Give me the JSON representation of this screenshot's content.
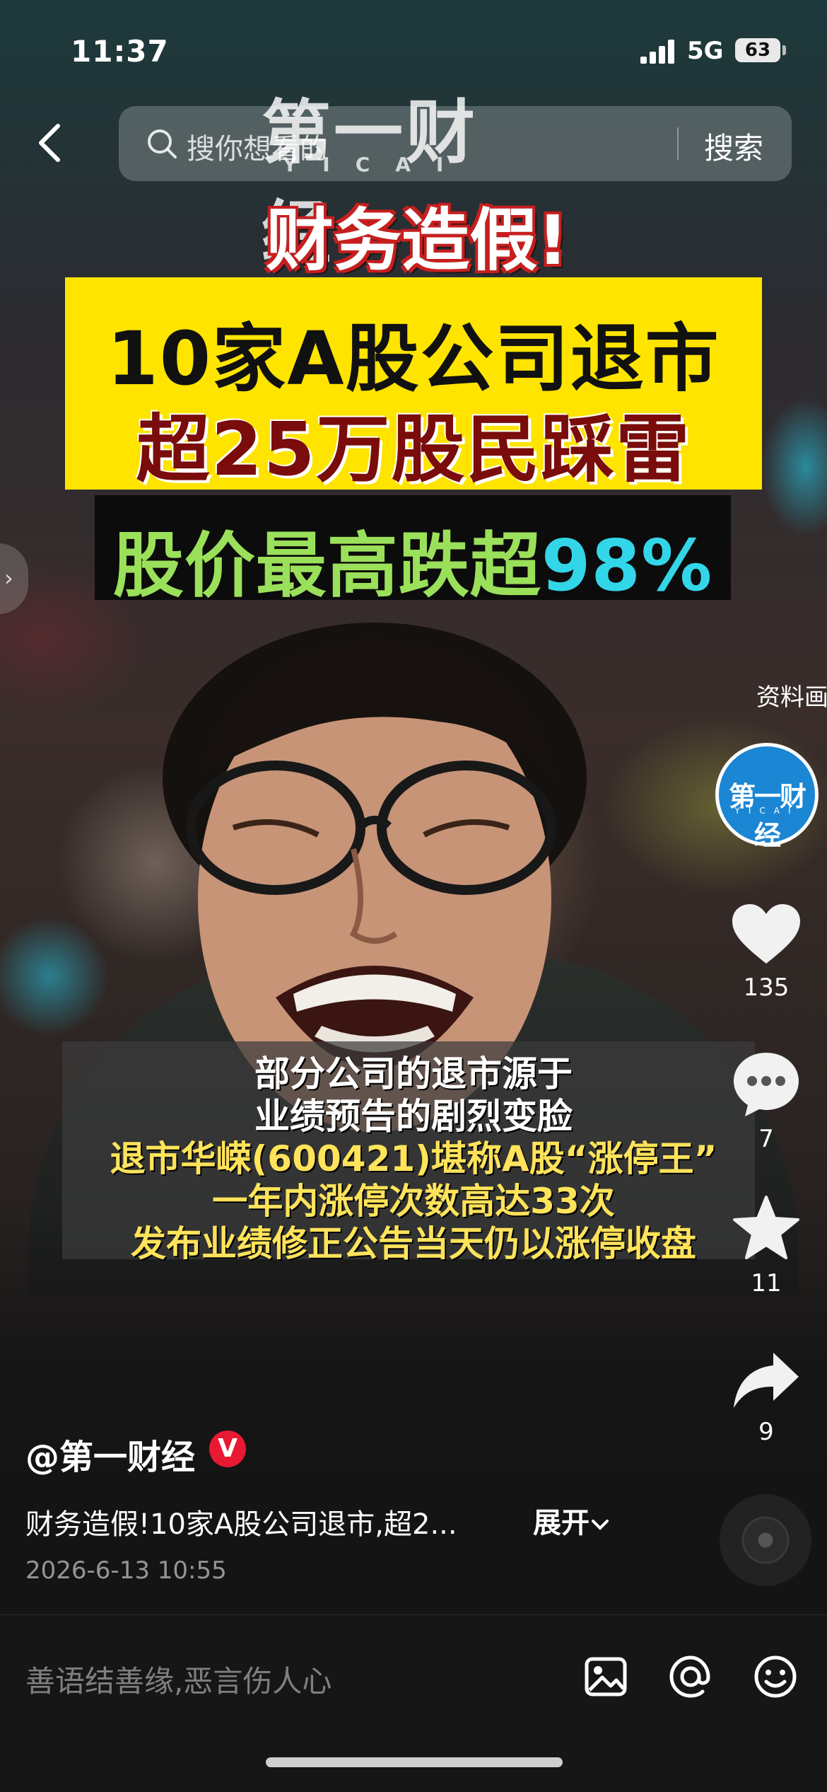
{
  "status_bar": {
    "time": "11:37",
    "network": "5G",
    "battery": "63"
  },
  "search": {
    "placeholder": "搜你想看的",
    "button": "搜索"
  },
  "watermark": {
    "main": "第一财经",
    "sub": "YICAI"
  },
  "headline": {
    "title": "财务造假!",
    "line1": "10家A股公司退市",
    "line2": "超25万股民踩雷",
    "line3_prefix": "股价最高跌超",
    "line3_pct": "98%"
  },
  "subtitles": [
    "部分公司的退市源于",
    "业绩预告的剧烈变脸",
    "退市华嵘(600421)堪称A股“涨停王”",
    "一年内涨停次数高达33次",
    "发布业绩修正公告当天仍以涨停收盘"
  ],
  "source_label": "资料画面",
  "avatar_logo": {
    "main": "第一财经",
    "sub": "YICAI"
  },
  "actions": {
    "likes": "135",
    "comments": "7",
    "favorites": "11",
    "shares": "9"
  },
  "author": {
    "name": "@第一财经",
    "badge": "V"
  },
  "description": {
    "text": "财务造假!10家A股公司退市,超2...",
    "expand": "展开"
  },
  "date": "2026-6-13 10:55",
  "comment_bar": {
    "placeholder": "善语结善缘,恶言伤人心"
  },
  "colors": {
    "yellow": "#ffe400",
    "title_red": "#c81e1e",
    "verified_red": "#e81932",
    "avatar_blue": "#1a86d4"
  }
}
